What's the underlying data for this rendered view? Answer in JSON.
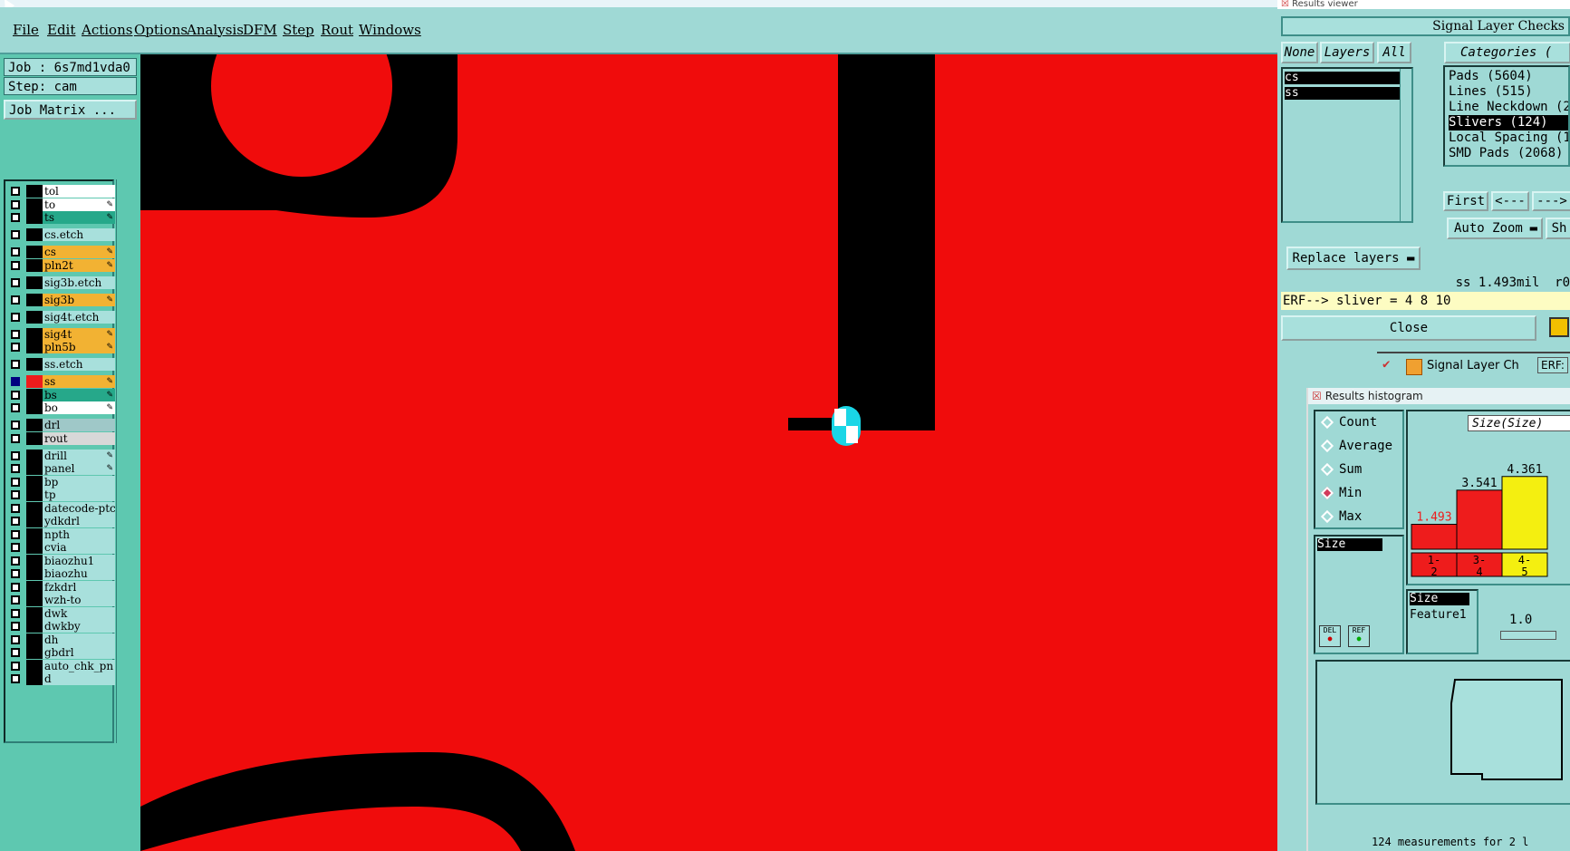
{
  "menu": [
    "File",
    "Edit",
    "Actions",
    "Options",
    "Analysis",
    "DFM",
    "Step",
    "Rout",
    "Windows"
  ],
  "job": {
    "job_label": "Job  : 6s7md1vda0",
    "step_label": "Step: cam",
    "matrix_button": "Job Matrix ..."
  },
  "layers": [
    {
      "name": "tol",
      "color": "#ffffff",
      "edit": false
    },
    {
      "name": "to",
      "color": "#ffffff",
      "edit": true
    },
    {
      "name": "ts",
      "color": "#26a88a",
      "edit": true
    },
    {
      "name": "cs.etch",
      "color": "#a8e0dc",
      "edit": false
    },
    {
      "name": "cs",
      "color": "#f2b233",
      "edit": true
    },
    {
      "name": "pln2t",
      "color": "#f2b233",
      "edit": true
    },
    {
      "name": "sig3b.etch",
      "color": "#a8e0dc",
      "edit": false
    },
    {
      "name": "sig3b",
      "color": "#f2b233",
      "edit": true
    },
    {
      "name": "sig4t.etch",
      "color": "#a8e0dc",
      "edit": false
    },
    {
      "name": "sig4t",
      "color": "#f2b233",
      "edit": true
    },
    {
      "name": "pln5b",
      "color": "#f2b233",
      "edit": true
    },
    {
      "name": "ss.etch",
      "color": "#a8e0dc",
      "edit": false
    },
    {
      "name": "ss",
      "color": "#f2b233",
      "edit": true
    },
    {
      "name": "bs",
      "color": "#26a88a",
      "edit": true
    },
    {
      "name": "bo",
      "color": "#ffffff",
      "edit": true
    },
    {
      "name": "drl",
      "color": "#9fc8c8",
      "edit": false
    },
    {
      "name": "rout",
      "color": "#d8d8d8",
      "edit": false
    },
    {
      "name": "drill",
      "color": "#a8e0dc",
      "edit": true
    },
    {
      "name": "panel",
      "color": "#a8e0dc",
      "edit": true
    },
    {
      "name": "bp",
      "color": "#a8e0dc",
      "edit": false
    },
    {
      "name": "tp",
      "color": "#a8e0dc",
      "edit": false
    },
    {
      "name": "datecode-ptc",
      "color": "#a8e0dc",
      "edit": false
    },
    {
      "name": "ydkdrl",
      "color": "#a8e0dc",
      "edit": false
    },
    {
      "name": "npth",
      "color": "#a8e0dc",
      "edit": false
    },
    {
      "name": "cvia",
      "color": "#a8e0dc",
      "edit": false
    },
    {
      "name": "biaozhu1",
      "color": "#a8e0dc",
      "edit": false
    },
    {
      "name": "biaozhu",
      "color": "#a8e0dc",
      "edit": false
    },
    {
      "name": "fzkdrl",
      "color": "#a8e0dc",
      "edit": false
    },
    {
      "name": "wzh-to",
      "color": "#a8e0dc",
      "edit": false
    },
    {
      "name": "dwk",
      "color": "#a8e0dc",
      "edit": false
    },
    {
      "name": "dwkby",
      "color": "#a8e0dc",
      "edit": false
    },
    {
      "name": "dh",
      "color": "#a8e0dc",
      "edit": false
    },
    {
      "name": "gbdrl",
      "color": "#a8e0dc",
      "edit": false
    },
    {
      "name": "auto_chk_pn",
      "color": "#a8e0dc",
      "edit": false
    },
    {
      "name": "d",
      "color": "#a8e0dc",
      "edit": false
    }
  ],
  "results_viewer": {
    "window_title": "Results viewer",
    "checklist_title": "Signal Layer Checks",
    "btn_none": "None",
    "btn_layers": "Layers",
    "btn_all": "All",
    "categories_header": "Categories (",
    "layer_items": [
      "cs",
      "ss"
    ],
    "categories": [
      "Pads (5604)",
      "Lines (515)",
      "Line Neckdown (2",
      "Slivers (124)",
      "Local Spacing (1",
      "SMD Pads (2068)"
    ],
    "selected_category": "Slivers (124)",
    "btn_first": "First",
    "btn_prev": "<---",
    "btn_next": "--->",
    "auto_zoom": "Auto Zoom",
    "show_abbr": "Sh",
    "replace_layers": "Replace layers",
    "measure": "ss 1.493mil  r0",
    "erf": "ERF--> sliver = 4 8 10",
    "close": "Close"
  },
  "taskbar": {
    "item1": "Signal Layer Ch",
    "item2": "ERF:"
  },
  "histogram": {
    "window_title": "Results histogram",
    "modes": [
      "Count",
      "Average",
      "Sum",
      "Min",
      "Max"
    ],
    "selected_mode": "Min",
    "size_item": "Size",
    "dropdown": "Size(Size)",
    "bar_values": [
      "1.493",
      "3.541",
      "4.361"
    ],
    "bar_colors": [
      "#ee1c1c",
      "#ee1c1c",
      "#f4ef10"
    ],
    "bar_value_colors": [
      "#ee1c1c",
      "#000000",
      "#000000"
    ],
    "bin_labels": [
      "1-\n2",
      "3-\n4",
      "4-\n5"
    ],
    "attr_list": [
      "Size",
      "Feature1"
    ],
    "slider_value": "1.0",
    "del_label": "DEL",
    "ref_label": "REF",
    "status": "124 measurements for 2 l"
  },
  "colors": {
    "canvas_bg": "#f00c0c",
    "feature": "#000000",
    "app_bg": "#9fd9d5"
  }
}
